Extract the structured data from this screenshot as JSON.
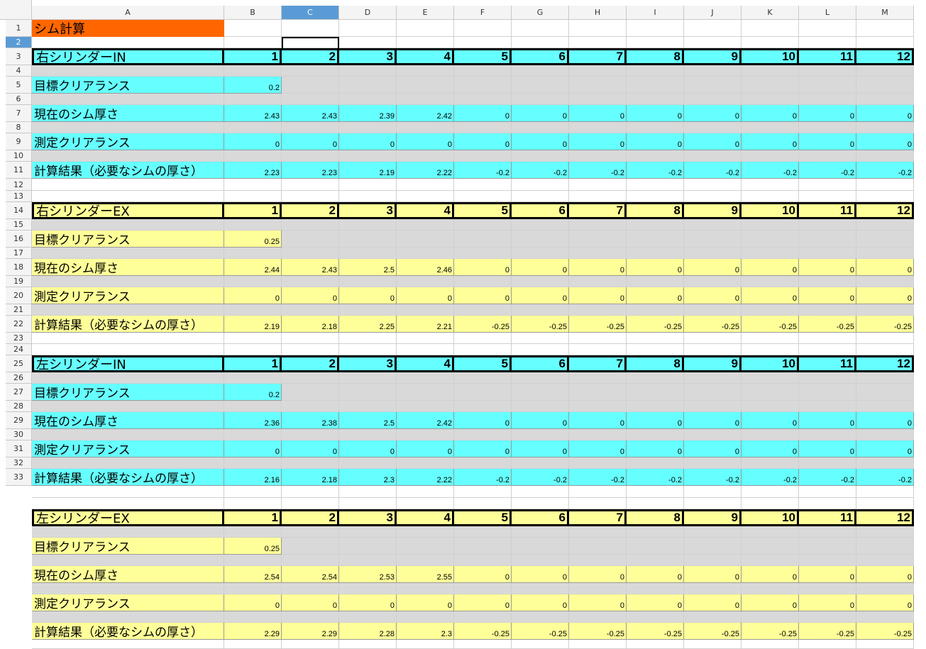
{
  "sheet": {
    "title": "シム計算",
    "columns": [
      "A",
      "B",
      "C",
      "D",
      "E",
      "F",
      "G",
      "H",
      "I",
      "J",
      "K",
      "L",
      "M"
    ],
    "row_numbers": [
      "1",
      "2",
      "3",
      "4",
      "5",
      "6",
      "7",
      "8",
      "9",
      "10",
      "11",
      "12",
      "13",
      "14",
      "15",
      "16",
      "17",
      "18",
      "19",
      "20",
      "21",
      "22",
      "23",
      "24",
      "25",
      "26",
      "27",
      "28",
      "29",
      "30",
      "31",
      "32",
      "33"
    ],
    "selected_column": "C",
    "selected_row": "2",
    "colors": {
      "cyan": "#66ffff",
      "yellow": "#ffff99",
      "gray": "#d9d9d9",
      "orange": "#ff6600",
      "selection_header": "#5b9bd5"
    },
    "labels": {
      "target": "目標クリアランス",
      "current": "現在のシム厚さ",
      "measured": "測定クリアランス",
      "result": "計算結果（必要なシムの厚さ）"
    },
    "sections": [
      {
        "title": "右シリンダーIN",
        "color": "cyan",
        "headers": [
          "1",
          "2",
          "3",
          "4",
          "5",
          "6",
          "7",
          "8",
          "9",
          "10",
          "11",
          "12"
        ],
        "target": "0.2",
        "current": [
          "2.43",
          "2.43",
          "2.39",
          "2.42",
          "0",
          "0",
          "0",
          "0",
          "0",
          "0",
          "0",
          "0"
        ],
        "measured": [
          "0",
          "0",
          "0",
          "0",
          "0",
          "0",
          "0",
          "0",
          "0",
          "0",
          "0",
          "0"
        ],
        "result": [
          "2.23",
          "2.23",
          "2.19",
          "2.22",
          "-0.2",
          "-0.2",
          "-0.2",
          "-0.2",
          "-0.2",
          "-0.2",
          "-0.2",
          "-0.2"
        ]
      },
      {
        "title": "右シリンダーEX",
        "color": "yellow",
        "headers": [
          "1",
          "2",
          "3",
          "4",
          "5",
          "6",
          "7",
          "8",
          "9",
          "10",
          "11",
          "12"
        ],
        "target": "0.25",
        "current": [
          "2.44",
          "2.43",
          "2.5",
          "2.46",
          "0",
          "0",
          "0",
          "0",
          "0",
          "0",
          "0",
          "0"
        ],
        "measured": [
          "0",
          "0",
          "0",
          "0",
          "0",
          "0",
          "0",
          "0",
          "0",
          "0",
          "0",
          "0"
        ],
        "result": [
          "2.19",
          "2.18",
          "2.25",
          "2.21",
          "-0.25",
          "-0.25",
          "-0.25",
          "-0.25",
          "-0.25",
          "-0.25",
          "-0.25",
          "-0.25"
        ]
      },
      {
        "title": "左シリンダーIN",
        "color": "cyan",
        "headers": [
          "1",
          "2",
          "3",
          "4",
          "5",
          "6",
          "7",
          "8",
          "9",
          "10",
          "11",
          "12"
        ],
        "target": "0.2",
        "current": [
          "2.36",
          "2.38",
          "2.5",
          "2.42",
          "0",
          "0",
          "0",
          "0",
          "0",
          "0",
          "0",
          "0"
        ],
        "measured": [
          "0",
          "0",
          "0",
          "0",
          "0",
          "0",
          "0",
          "0",
          "0",
          "0",
          "0",
          "0"
        ],
        "result": [
          "2.16",
          "2.18",
          "2.3",
          "2.22",
          "-0.2",
          "-0.2",
          "-0.2",
          "-0.2",
          "-0.2",
          "-0.2",
          "-0.2",
          "-0.2"
        ]
      },
      {
        "title": "左シリンダーEX",
        "color": "yellow",
        "headers": [
          "1",
          "2",
          "3",
          "4",
          "5",
          "6",
          "7",
          "8",
          "9",
          "10",
          "11",
          "12"
        ],
        "target": "0.25",
        "current": [
          "2.54",
          "2.54",
          "2.53",
          "2.55",
          "0",
          "0",
          "0",
          "0",
          "0",
          "0",
          "0",
          "0"
        ],
        "measured": [
          "0",
          "0",
          "0",
          "0",
          "0",
          "0",
          "0",
          "0",
          "0",
          "0",
          "0",
          "0"
        ],
        "result": [
          "2.29",
          "2.29",
          "2.28",
          "2.3",
          "-0.25",
          "-0.25",
          "-0.25",
          "-0.25",
          "-0.25",
          "-0.25",
          "-0.25",
          "-0.25"
        ]
      }
    ]
  }
}
